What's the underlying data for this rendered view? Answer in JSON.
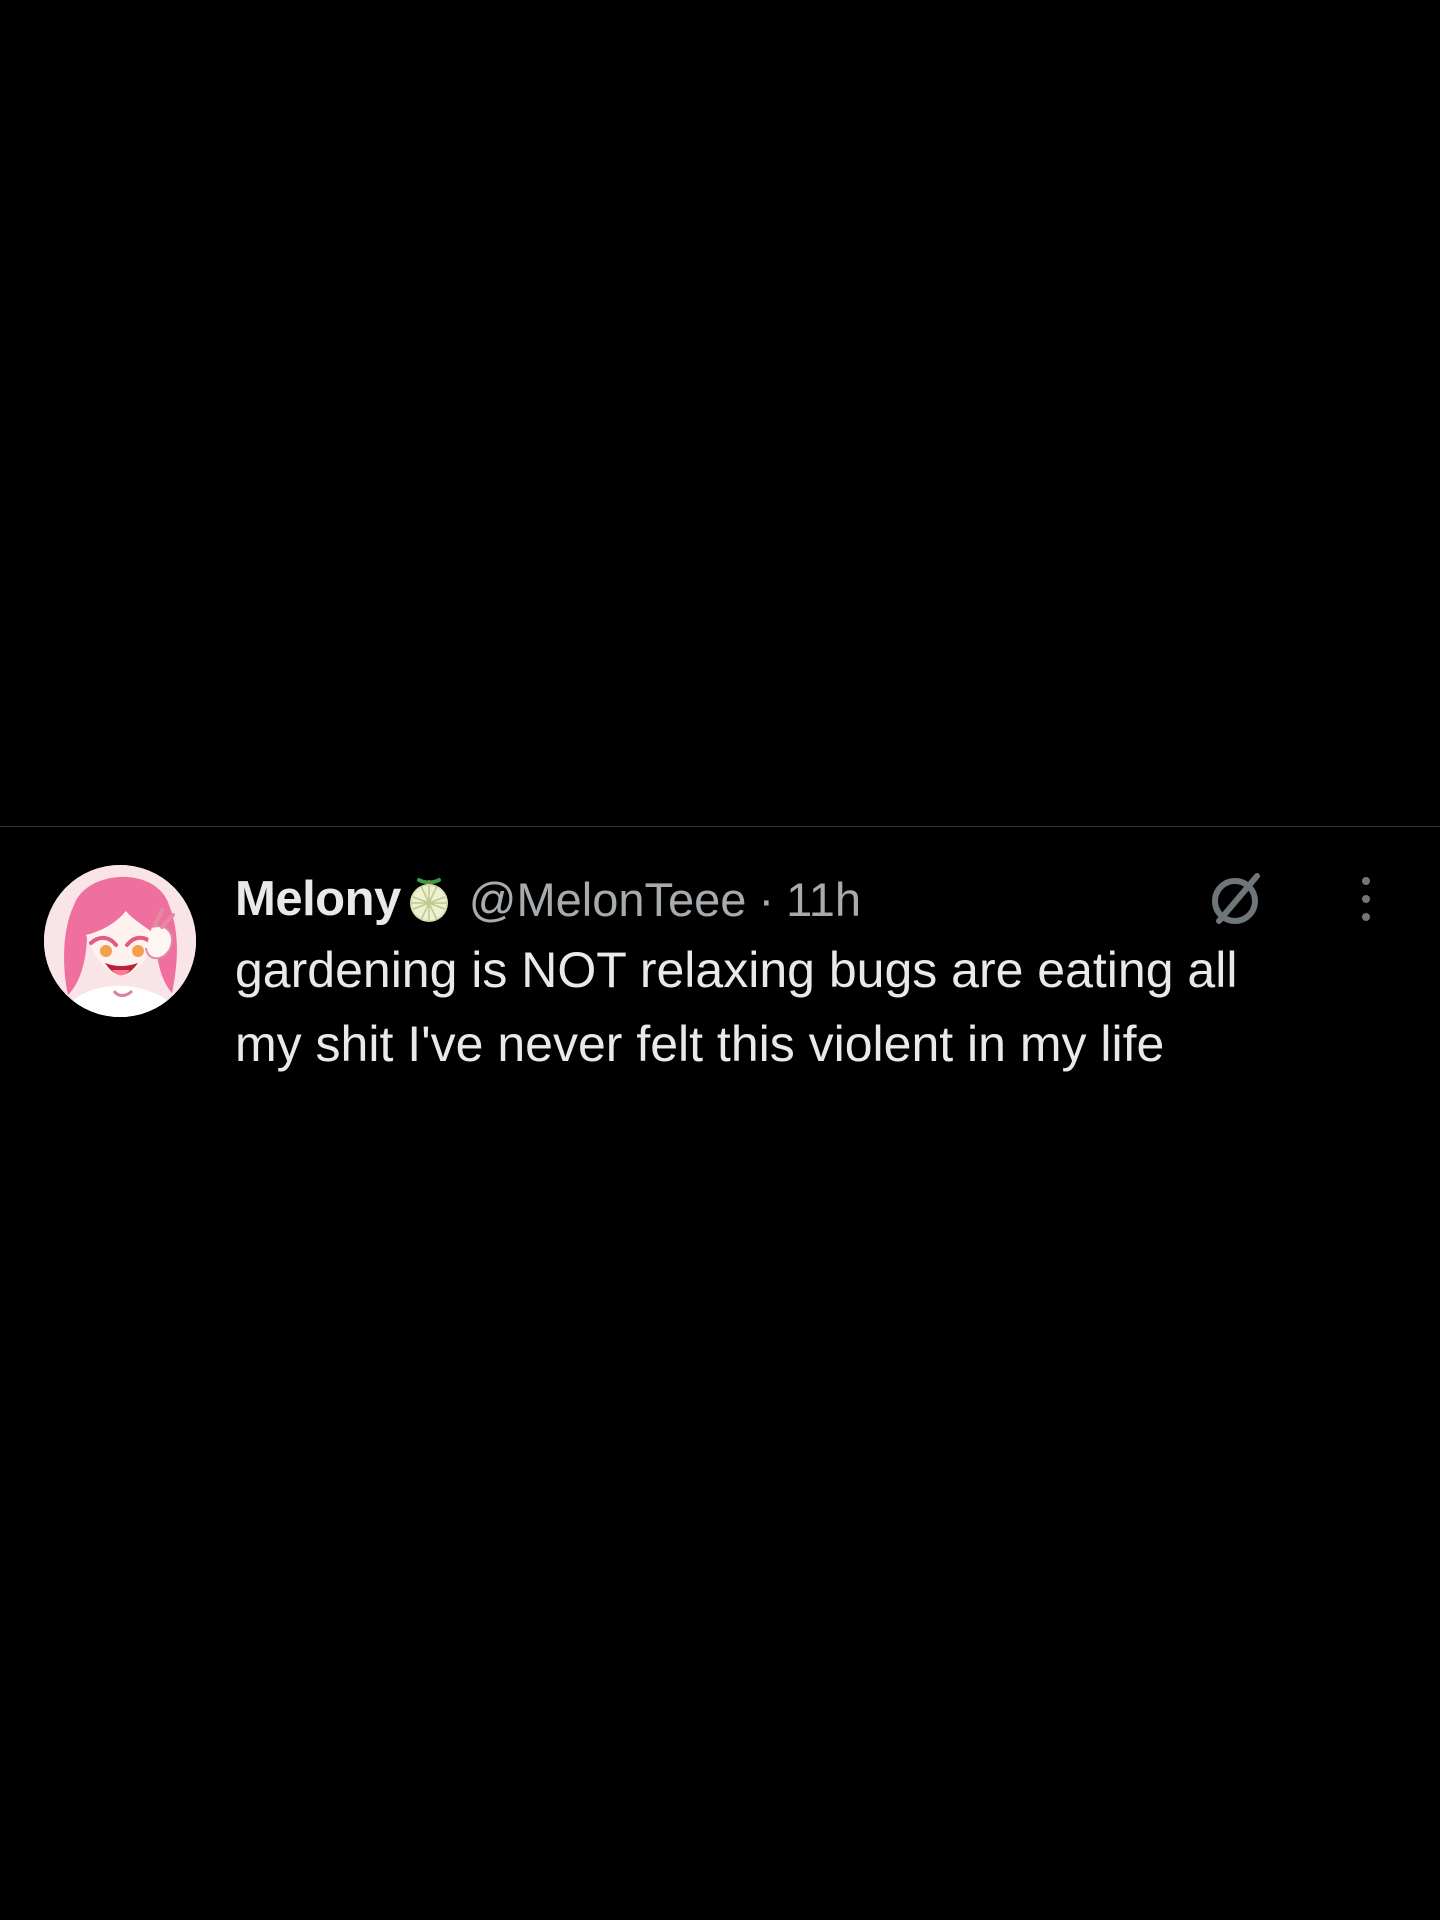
{
  "tweet": {
    "author": {
      "display_name": "Melony",
      "name_emoji": "melon-icon",
      "handle": "@MelonTeee",
      "avatar": "anime-avatar-pink-hair"
    },
    "separator": "·",
    "time": "11h",
    "text": "gardening is NOT relaxing bugs are eating all\nmy shit I've never felt this violent in my life",
    "actions": {
      "grok_icon": "grok-icon",
      "more_icon": "more-vertical-icon"
    }
  },
  "colors": {
    "background": "#000000",
    "text_primary": "#e7e9ea",
    "text_secondary": "#a7abae",
    "divider": "#2f3336"
  }
}
